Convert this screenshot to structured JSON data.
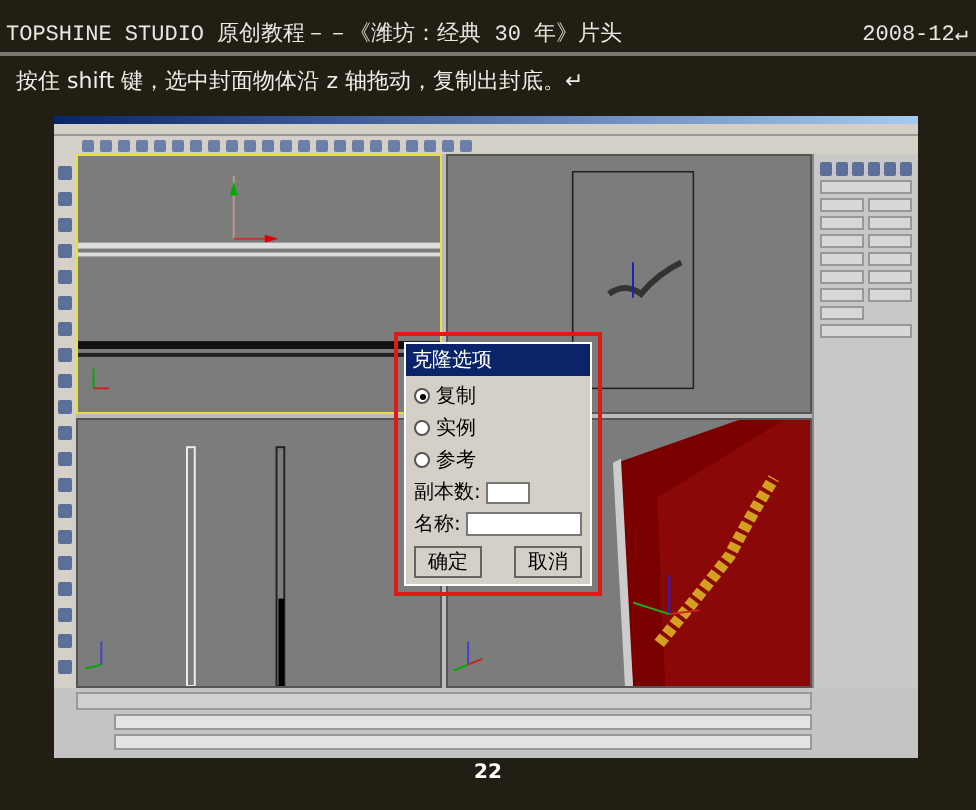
{
  "header": {
    "title": "TOPSHINE STUDIO 原创教程－－《潍坊：经典 30 年》片头",
    "date": "2008-12↵"
  },
  "instruction": "按住 shift 键，选中封面物体沿 z 轴拖动，复制出封底。↵",
  "screenshot": {
    "viewports": [
      {
        "kind": "top",
        "active": true
      },
      {
        "kind": "front",
        "active": false
      },
      {
        "kind": "left",
        "active": false
      },
      {
        "kind": "perspective",
        "active": false
      }
    ],
    "dialog": {
      "title": "克隆选项",
      "options": [
        {
          "label": "复制",
          "selected": true
        },
        {
          "label": "实例",
          "selected": false
        },
        {
          "label": "参考",
          "selected": false
        }
      ],
      "copies_label": "副本数:",
      "name_label": "名称:",
      "buttons": [
        "确定",
        "取消"
      ]
    }
  },
  "page_number": "22"
}
